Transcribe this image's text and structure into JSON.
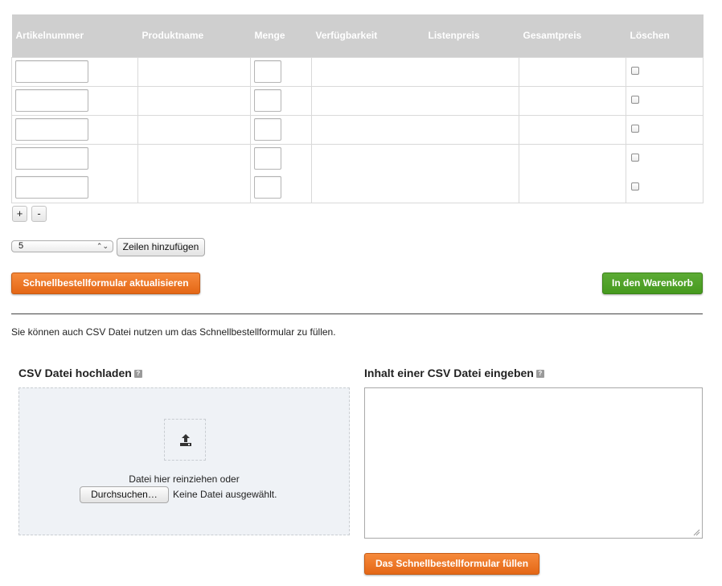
{
  "table": {
    "headers": [
      "Artikelnummer",
      "Produktname",
      "Menge",
      "Verfügbarkeit",
      "Listenpreis",
      "Gesamtpreis",
      "Löschen"
    ],
    "rows": [
      {
        "artikelnummer": "",
        "menge": ""
      },
      {
        "artikelnummer": "",
        "menge": ""
      },
      {
        "artikelnummer": "",
        "menge": ""
      },
      {
        "artikelnummer": "",
        "menge": ""
      },
      {
        "artikelnummer": "",
        "menge": ""
      }
    ]
  },
  "row_controls": {
    "plus_label": "+",
    "minus_label": "-"
  },
  "add_rows": {
    "selected_value": "5",
    "button_label": "Zeilen hinzufügen"
  },
  "actions": {
    "update_label": "Schnellbestellformular aktualisieren",
    "cart_label": "In den Warenkorb"
  },
  "csv": {
    "info_text": "Sie können auch CSV Datei nutzen um das Schnellbestellformular zu füllen.",
    "upload_title": "CSV Datei hochladen",
    "help_glyph": "?",
    "drop_hint": "Datei hier reinziehen oder",
    "browse_label": "Durchsuchen…",
    "no_file_text": "Keine Datei ausgewählt.",
    "content_title": "Inhalt einer CSV Datei eingeben",
    "textarea_value": "",
    "fill_label": "Das Schnellbestellformular füllen"
  },
  "colors": {
    "header_bg": "#cfcfcf",
    "orange": "#f0792a",
    "green": "#52a32a",
    "upload_bg": "#eff2f6"
  },
  "icons": {
    "upload": "upload-icon",
    "help": "help-icon",
    "select_arrows": "up-down-arrows-icon",
    "resize": "resize-grip-icon"
  }
}
